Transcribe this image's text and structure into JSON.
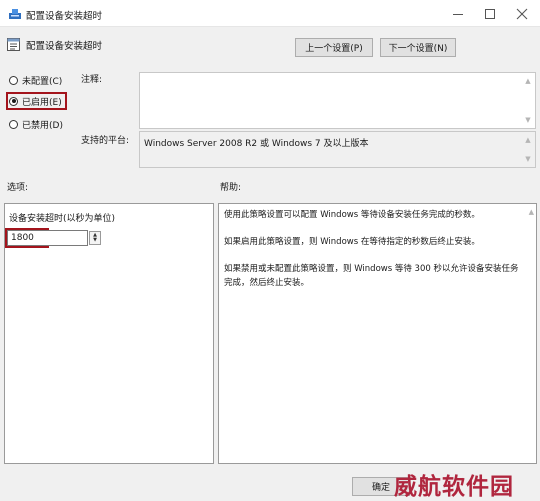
{
  "window": {
    "title": "配置设备安装超时",
    "heading": "配置设备安装超时"
  },
  "nav": {
    "prev_label": "上一个设置(P)",
    "next_label": "下一个设置(N)"
  },
  "state": {
    "options": [
      {
        "label": "未配置(C)",
        "selected": false
      },
      {
        "label": "已启用(E)",
        "selected": true
      },
      {
        "label": "已禁用(D)",
        "selected": false
      }
    ]
  },
  "comment": {
    "label": "注释:",
    "value": ""
  },
  "platform": {
    "label": "支持的平台:",
    "value": "Windows Server 2008 R2 或 Windows 7 及以上版本"
  },
  "options_section": {
    "label": "选项:",
    "field_label": "设备安装超时(以秒为单位)",
    "field_value": "1800"
  },
  "help_section": {
    "label": "帮助:",
    "paragraphs": [
      "使用此策略设置可以配置 Windows 等待设备安装任务完成的秒数。",
      "如果启用此策略设置，则 Windows 在等待指定的秒数后终止安装。",
      "如果禁用或未配置此策略设置，则 Windows 等待 300 秒以允许设备安装任务完成，然后终止安装。"
    ]
  },
  "footer": {
    "ok_label": "确定",
    "watermark": "威航软件园"
  },
  "colors": {
    "highlight": "#a3141c",
    "watermark": "#b0263e"
  }
}
